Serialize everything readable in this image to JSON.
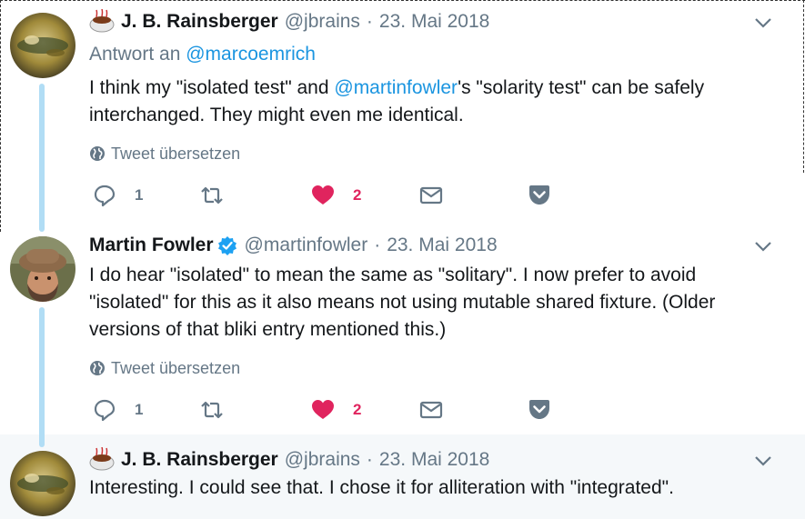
{
  "tweets": [
    {
      "author_name": "J. B. Rainsberger",
      "handle": "@jbrains",
      "date": "23. Mai 2018",
      "reply_to_prefix": "Antwort an ",
      "reply_to_handle": "@marcoemrich",
      "text_before": "I think my \"isolated test\" and ",
      "text_mention": "@martinfowler",
      "text_after": "'s \"solarity test\" can be safely interchanged. They might even me identical.",
      "translate_label": "Tweet übersetzen",
      "reply_count": "1",
      "like_count": "2"
    },
    {
      "author_name": "Martin Fowler",
      "handle": "@martinfowler",
      "date": "23. Mai 2018",
      "verified": true,
      "text": "I do hear \"isolated\" to mean the same as \"solitary\". I now prefer to avoid \"isolated\" for this as it also means not using mutable shared fixture. (Older versions of that bliki entry mentioned this.)",
      "translate_label": "Tweet übersetzen",
      "reply_count": "1",
      "like_count": "2"
    },
    {
      "author_name": "J. B. Rainsberger",
      "handle": "@jbrains",
      "date": "23. Mai 2018",
      "text": "Interesting. I could see that. I chose it for alliteration with \"integrated\"."
    }
  ],
  "separator": "·",
  "colors": {
    "link": "#1b95e0",
    "secondary_text": "#657786",
    "like": "#e0245e",
    "thread_line": "#b1ddf5",
    "highlight_bg": "#f5f8fa",
    "verified": "#1da1f2"
  },
  "icons": {
    "caret": "chevron-down-icon",
    "translate": "globe-icon",
    "reply": "reply-icon",
    "retweet": "retweet-icon",
    "like": "heart-icon",
    "dm": "envelope-icon",
    "pocket": "pocket-icon",
    "verified": "verified-badge-icon",
    "emoji": "coffee-cup-emoji"
  }
}
